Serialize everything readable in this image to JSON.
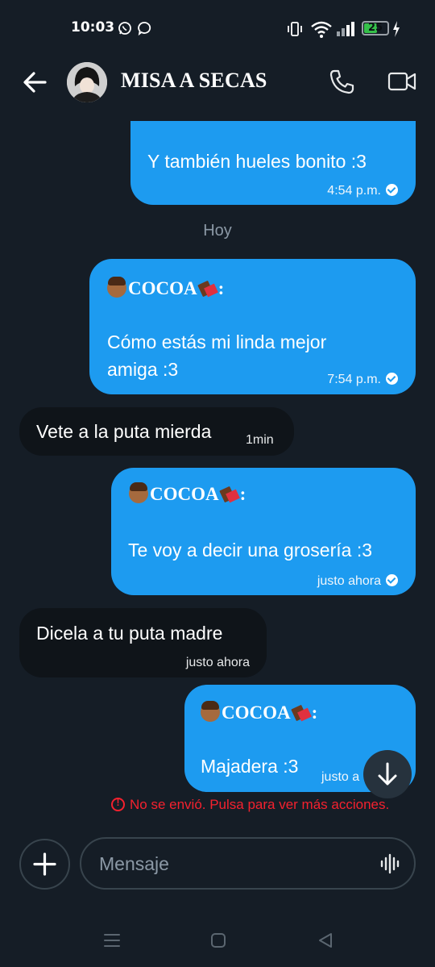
{
  "status_bar": {
    "time": "10:03",
    "battery": "25",
    "battery_level": 0.25
  },
  "header": {
    "contact_name": "MISA A SECAS",
    "back_icon": "arrow-left-icon",
    "call_icon": "phone-icon",
    "video_icon": "video-camera-icon"
  },
  "messages": [
    {
      "dir": "out",
      "text": "Y también hueles bonito :3",
      "time": "4:54 p.m."
    },
    {
      "dir": "separator",
      "text": "Hoy"
    },
    {
      "dir": "out",
      "sender": "COCOA",
      "text": "Cómo estás mi linda mejor amiga :3",
      "time": "7:54 p.m."
    },
    {
      "dir": "in",
      "text": "Vete a la puta mierda",
      "time": "1min"
    },
    {
      "dir": "out",
      "sender": "COCOA",
      "text": "Te voy a decir una grosería :3",
      "time": "justo ahora"
    },
    {
      "dir": "in",
      "text": "Dicela a tu puta madre",
      "time": "justo ahora"
    },
    {
      "dir": "out",
      "sender": "COCOA",
      "text": "Majadera :3",
      "time": "justo a"
    }
  ],
  "error_text": "No se envió. Pulsa para ver más acciones.",
  "composer": {
    "placeholder": "Mensaje"
  },
  "colors": {
    "outgoing_bubble": "#1d9bf0",
    "incoming_bubble": "#0f1419",
    "background": "#151d26",
    "error": "#f4212e"
  }
}
